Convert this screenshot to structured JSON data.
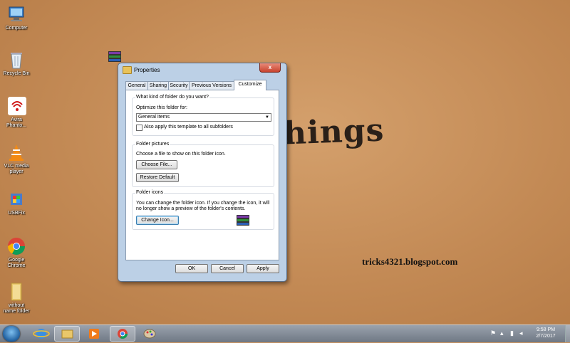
{
  "desktop": {
    "scribble": "hings",
    "blog": "tricks4321.blogspot.com",
    "icons": [
      {
        "label": "Computer"
      },
      {
        "label": "Recycle Bin"
      },
      {
        "label": "Avira Phanto..."
      },
      {
        "label": "VLC media player"
      },
      {
        "label": "USBFix"
      },
      {
        "label": "Google Chrome"
      },
      {
        "label": "without name folder"
      }
    ]
  },
  "dialog": {
    "title": "Properties",
    "close": "x",
    "tabs": [
      "General",
      "Sharing",
      "Security",
      "Previous Versions",
      "Customize"
    ],
    "active_tab": "Customize",
    "group1": {
      "label": "What kind of folder do you want?",
      "optimize_label": "Optimize this folder for:",
      "select_value": "General Items",
      "checkbox_label": "Also apply this template to all subfolders",
      "checked": false
    },
    "group2": {
      "label": "Folder pictures",
      "desc": "Choose a file to show on this folder icon.",
      "choose_file": "Choose File...",
      "restore_default": "Restore Default"
    },
    "group3": {
      "label": "Folder icons",
      "desc1": "You can change the folder icon. If you change the icon, it will",
      "desc2": "no longer show a preview of the folder's contents.",
      "change_icon": "Change Icon..."
    },
    "buttons": {
      "ok": "OK",
      "cancel": "Cancel",
      "apply": "Apply"
    }
  },
  "taskbar": {
    "time": "9:58 PM",
    "date": "2/7/2017"
  }
}
